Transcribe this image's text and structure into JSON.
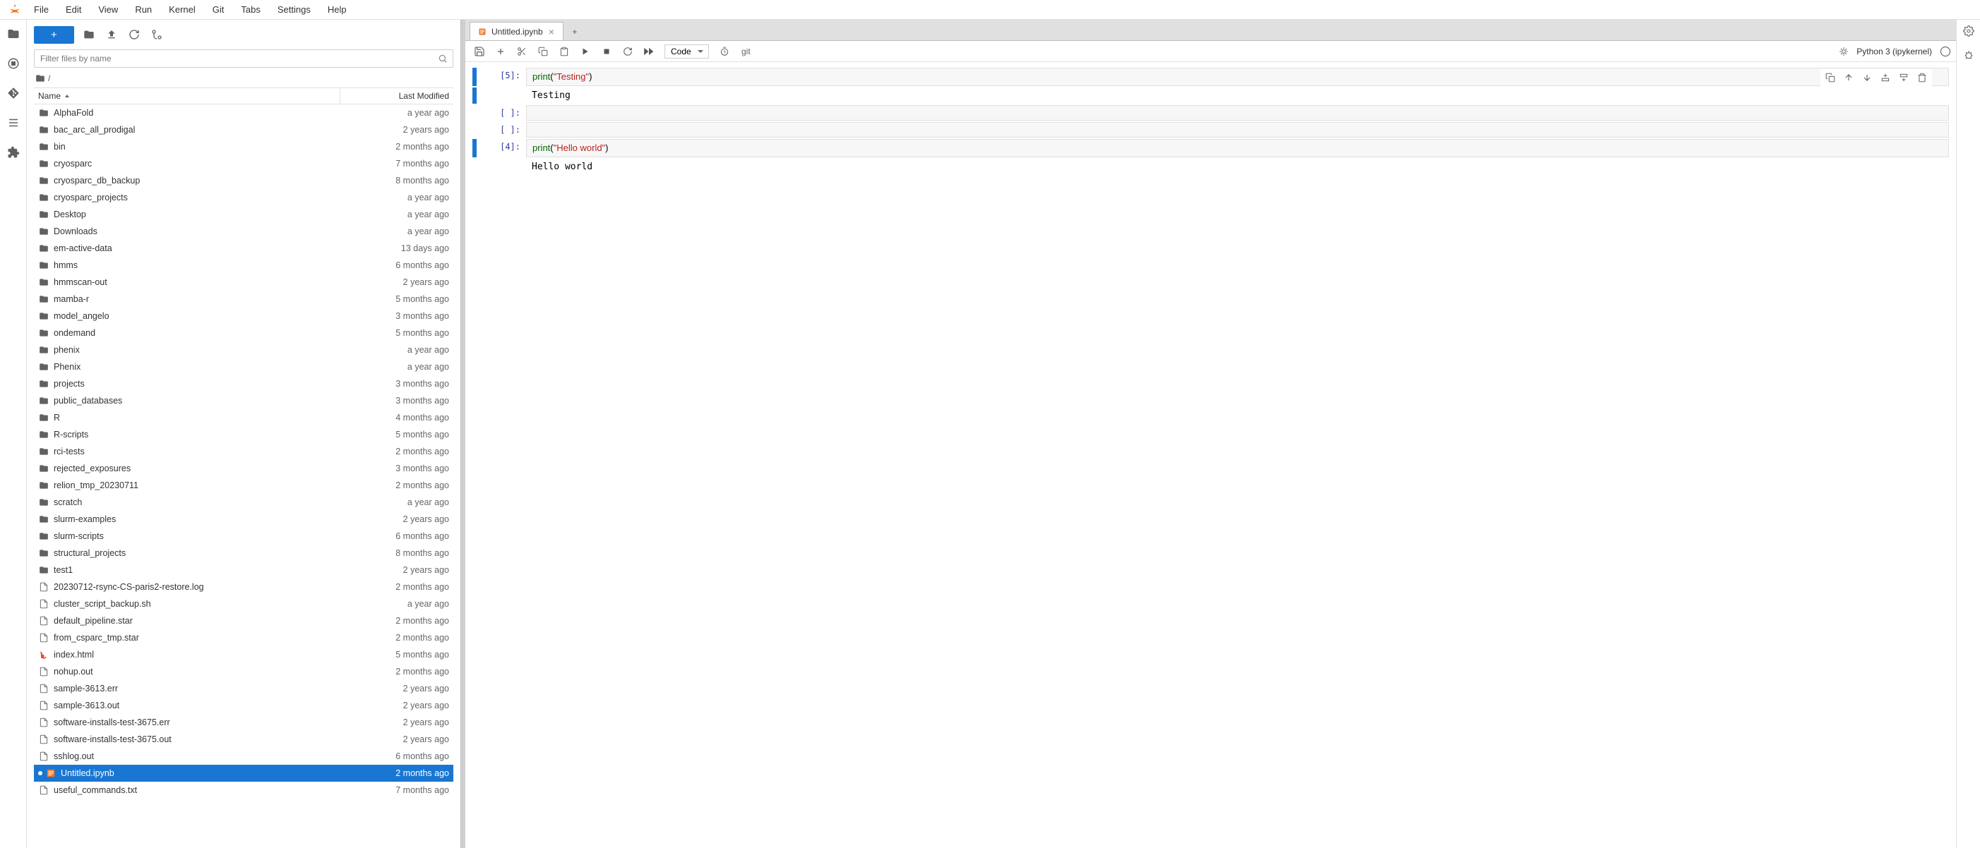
{
  "menu": [
    "File",
    "Edit",
    "View",
    "Run",
    "Kernel",
    "Git",
    "Tabs",
    "Settings",
    "Help"
  ],
  "activitybar": [
    {
      "name": "folder-icon",
      "active": true
    },
    {
      "name": "running-icon"
    },
    {
      "name": "git-icon"
    },
    {
      "name": "toc-icon"
    },
    {
      "name": "extension-icon"
    }
  ],
  "filebrowser": {
    "search_placeholder": "Filter files by name",
    "breadcrumb": "/",
    "header_name": "Name",
    "header_modified": "Last Modified",
    "items": [
      {
        "type": "folder",
        "name": "AlphaFold",
        "modified": "a year ago"
      },
      {
        "type": "folder",
        "name": "bac_arc_all_prodigal",
        "modified": "2 years ago"
      },
      {
        "type": "folder",
        "name": "bin",
        "modified": "2 months ago"
      },
      {
        "type": "folder",
        "name": "cryosparc",
        "modified": "7 months ago"
      },
      {
        "type": "folder",
        "name": "cryosparc_db_backup",
        "modified": "8 months ago"
      },
      {
        "type": "folder",
        "name": "cryosparc_projects",
        "modified": "a year ago"
      },
      {
        "type": "folder",
        "name": "Desktop",
        "modified": "a year ago"
      },
      {
        "type": "folder",
        "name": "Downloads",
        "modified": "a year ago"
      },
      {
        "type": "folder",
        "name": "em-active-data",
        "modified": "13 days ago"
      },
      {
        "type": "folder",
        "name": "hmms",
        "modified": "6 months ago"
      },
      {
        "type": "folder",
        "name": "hmmscan-out",
        "modified": "2 years ago"
      },
      {
        "type": "folder",
        "name": "mamba-r",
        "modified": "5 months ago"
      },
      {
        "type": "folder",
        "name": "model_angelo",
        "modified": "3 months ago"
      },
      {
        "type": "folder",
        "name": "ondemand",
        "modified": "5 months ago"
      },
      {
        "type": "folder",
        "name": "phenix",
        "modified": "a year ago"
      },
      {
        "type": "folder",
        "name": "Phenix",
        "modified": "a year ago"
      },
      {
        "type": "folder",
        "name": "projects",
        "modified": "3 months ago"
      },
      {
        "type": "folder",
        "name": "public_databases",
        "modified": "3 months ago"
      },
      {
        "type": "folder",
        "name": "R",
        "modified": "4 months ago"
      },
      {
        "type": "folder",
        "name": "R-scripts",
        "modified": "5 months ago"
      },
      {
        "type": "folder",
        "name": "rci-tests",
        "modified": "2 months ago"
      },
      {
        "type": "folder",
        "name": "rejected_exposures",
        "modified": "3 months ago"
      },
      {
        "type": "folder",
        "name": "relion_tmp_20230711",
        "modified": "2 months ago"
      },
      {
        "type": "folder",
        "name": "scratch",
        "modified": "a year ago"
      },
      {
        "type": "folder",
        "name": "slurm-examples",
        "modified": "2 years ago"
      },
      {
        "type": "folder",
        "name": "slurm-scripts",
        "modified": "6 months ago"
      },
      {
        "type": "folder",
        "name": "structural_projects",
        "modified": "8 months ago"
      },
      {
        "type": "folder",
        "name": "test1",
        "modified": "2 years ago"
      },
      {
        "type": "file",
        "name": "20230712-rsync-CS-paris2-restore.log",
        "modified": "2 months ago"
      },
      {
        "type": "file",
        "name": "cluster_script_backup.sh",
        "modified": "a year ago"
      },
      {
        "type": "file",
        "name": "default_pipeline.star",
        "modified": "2 months ago"
      },
      {
        "type": "file",
        "name": "from_csparc_tmp.star",
        "modified": "2 months ago"
      },
      {
        "type": "html",
        "name": "index.html",
        "modified": "5 months ago"
      },
      {
        "type": "file",
        "name": "nohup.out",
        "modified": "2 months ago"
      },
      {
        "type": "file",
        "name": "sample-3613.err",
        "modified": "2 years ago"
      },
      {
        "type": "file",
        "name": "sample-3613.out",
        "modified": "2 years ago"
      },
      {
        "type": "file",
        "name": "software-installs-test-3675.err",
        "modified": "2 years ago"
      },
      {
        "type": "file",
        "name": "software-installs-test-3675.out",
        "modified": "2 years ago"
      },
      {
        "type": "file",
        "name": "sshlog.out",
        "modified": "6 months ago"
      },
      {
        "type": "notebook",
        "name": "Untitled.ipynb",
        "modified": "2 months ago",
        "selected": true,
        "running": true
      },
      {
        "type": "file",
        "name": "useful_commands.txt",
        "modified": "7 months ago"
      }
    ]
  },
  "tabs": [
    {
      "label": "Untitled.ipynb",
      "icon": "notebook-icon",
      "closable": true
    }
  ],
  "nb_toolbar": {
    "cell_type": "Code",
    "git_label": "git",
    "kernel_name": "Python 3 (ipykernel)"
  },
  "cells": [
    {
      "kind": "code",
      "prompt": "[5]:",
      "tokens": [
        {
          "t": "fn",
          "v": "print"
        },
        {
          "t": "paren",
          "v": "("
        },
        {
          "t": "str",
          "v": "\"Testing\""
        },
        {
          "t": "paren",
          "v": ")"
        }
      ],
      "executed": true
    },
    {
      "kind": "output",
      "text": "Testing"
    },
    {
      "kind": "code",
      "prompt": "[ ]:",
      "tokens": [],
      "executed": false
    },
    {
      "kind": "code",
      "prompt": "[ ]:",
      "tokens": [],
      "executed": false
    },
    {
      "kind": "code",
      "prompt": "[4]:",
      "tokens": [
        {
          "t": "fn",
          "v": "print"
        },
        {
          "t": "paren",
          "v": "("
        },
        {
          "t": "str",
          "v": "\"Hello world\""
        },
        {
          "t": "paren",
          "v": ")"
        }
      ],
      "executed": false,
      "last": true
    },
    {
      "kind": "output",
      "text": "Hello world"
    }
  ],
  "cell_toolbar_icons": [
    "duplicate-icon",
    "move-up-icon",
    "move-down-icon",
    "insert-above-icon",
    "insert-below-icon",
    "delete-icon"
  ]
}
